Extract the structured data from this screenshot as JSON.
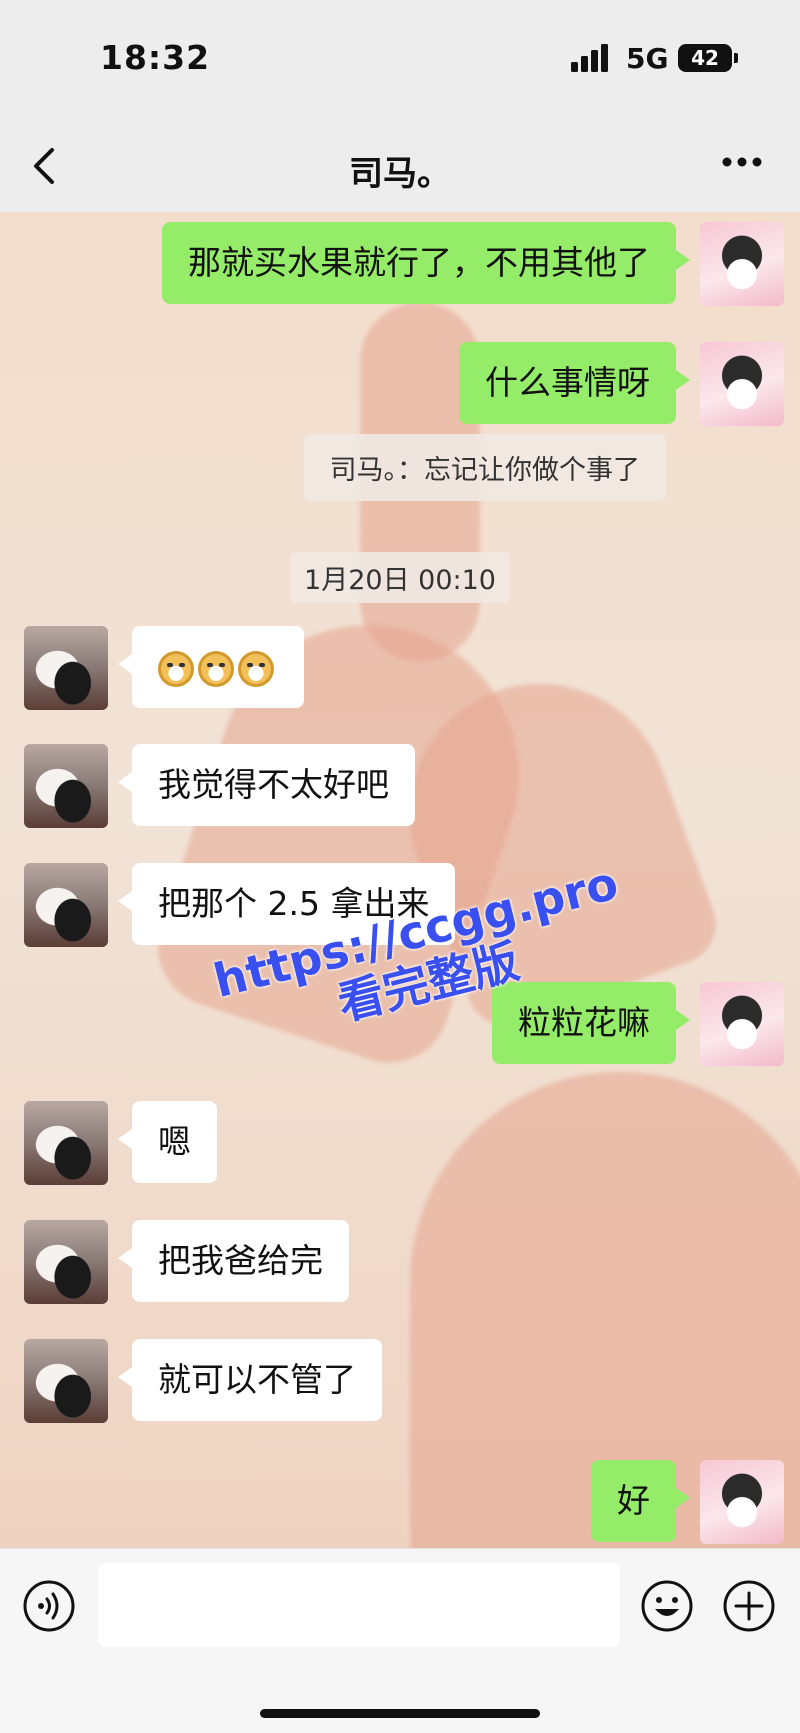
{
  "status_bar": {
    "time": "18:32",
    "network": "5G",
    "battery": "42"
  },
  "nav": {
    "title": "司马。"
  },
  "messages": [
    {
      "sender": "me",
      "text": "那就买水果就行了，不用其他了"
    },
    {
      "sender": "me",
      "text": "什么事情呀"
    },
    {
      "sender": "quote",
      "text": "司马。：忘记让你做个事了"
    },
    {
      "sender": "time",
      "text": "1月20日 00:10"
    },
    {
      "sender": "other",
      "text": "",
      "emoji": [
        "doge-emoji",
        "doge-emoji",
        "doge-emoji"
      ]
    },
    {
      "sender": "other",
      "text": "我觉得不太好吧"
    },
    {
      "sender": "other",
      "text": "把那个 2.5 拿出来"
    },
    {
      "sender": "me",
      "text": "粒粒花嘛"
    },
    {
      "sender": "other",
      "text": "嗯"
    },
    {
      "sender": "other",
      "text": "把我爸给完"
    },
    {
      "sender": "other",
      "text": "就可以不管了"
    },
    {
      "sender": "me",
      "text": "好"
    }
  ],
  "watermark": {
    "line1": "https://ccgg.pro",
    "line2": "看完整版"
  },
  "input": {
    "value": "",
    "placeholder": ""
  },
  "colors": {
    "self_bubble": "#95ec69",
    "other_bubble": "#ffffff",
    "watermark": "#3a4ff0"
  }
}
